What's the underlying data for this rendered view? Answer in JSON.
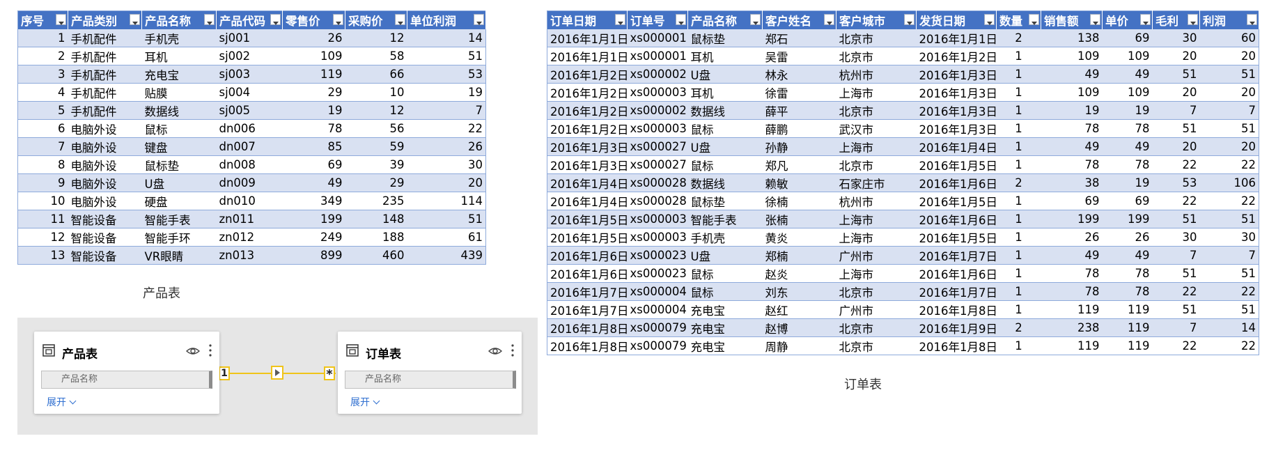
{
  "product_table": {
    "headers": [
      "序号",
      "产品类别",
      "产品名称",
      "产品代码",
      "零售价",
      "采购价",
      "单位利润"
    ],
    "rows": [
      [
        "1",
        "手机配件",
        "手机壳",
        "sj001",
        "26",
        "12",
        "14"
      ],
      [
        "2",
        "手机配件",
        "耳机",
        "sj002",
        "109",
        "58",
        "51"
      ],
      [
        "3",
        "手机配件",
        "充电宝",
        "sj003",
        "119",
        "66",
        "53"
      ],
      [
        "4",
        "手机配件",
        "贴膜",
        "sj004",
        "29",
        "10",
        "19"
      ],
      [
        "5",
        "手机配件",
        "数据线",
        "sj005",
        "19",
        "12",
        "7"
      ],
      [
        "6",
        "电脑外设",
        "鼠标",
        "dn006",
        "78",
        "56",
        "22"
      ],
      [
        "7",
        "电脑外设",
        "键盘",
        "dn007",
        "85",
        "59",
        "26"
      ],
      [
        "8",
        "电脑外设",
        "鼠标垫",
        "dn008",
        "69",
        "39",
        "30"
      ],
      [
        "9",
        "电脑外设",
        "U盘",
        "dn009",
        "49",
        "29",
        "20"
      ],
      [
        "10",
        "电脑外设",
        "硬盘",
        "dn010",
        "349",
        "235",
        "114"
      ],
      [
        "11",
        "智能设备",
        "智能手表",
        "zn011",
        "199",
        "148",
        "51"
      ],
      [
        "12",
        "智能设备",
        "智能手环",
        "zn012",
        "249",
        "188",
        "61"
      ],
      [
        "13",
        "智能设备",
        "VR眼睛",
        "zn013",
        "899",
        "460",
        "439"
      ]
    ],
    "caption": "产品表"
  },
  "order_table": {
    "headers": [
      "订单日期",
      "订单号",
      "产品名称",
      "客户姓名",
      "客户城市",
      "发货日期",
      "数量",
      "销售额",
      "单价",
      "毛利",
      "利润"
    ],
    "rows": [
      [
        "2016年1月1日",
        "xs000001",
        "鼠标垫",
        "郑石",
        "北京市",
        "2016年1月1日",
        "2",
        "138",
        "69",
        "30",
        "60"
      ],
      [
        "2016年1月1日",
        "xs000001",
        "耳机",
        "吴雷",
        "北京市",
        "2016年1月2日",
        "1",
        "109",
        "109",
        "20",
        "20"
      ],
      [
        "2016年1月2日",
        "xs000002",
        "U盘",
        "林永",
        "杭州市",
        "2016年1月3日",
        "1",
        "49",
        "49",
        "51",
        "51"
      ],
      [
        "2016年1月2日",
        "xs000003",
        "耳机",
        "徐雷",
        "上海市",
        "2016年1月3日",
        "1",
        "109",
        "109",
        "20",
        "20"
      ],
      [
        "2016年1月2日",
        "xs000002",
        "数据线",
        "薛平",
        "北京市",
        "2016年1月3日",
        "1",
        "19",
        "19",
        "7",
        "7"
      ],
      [
        "2016年1月2日",
        "xs000003",
        "鼠标",
        "薛鹏",
        "武汉市",
        "2016年1月3日",
        "1",
        "78",
        "78",
        "51",
        "51"
      ],
      [
        "2016年1月3日",
        "xs000027",
        "U盘",
        "孙静",
        "上海市",
        "2016年1月4日",
        "1",
        "49",
        "49",
        "20",
        "20"
      ],
      [
        "2016年1月3日",
        "xs000027",
        "鼠标",
        "郑凡",
        "北京市",
        "2016年1月5日",
        "1",
        "78",
        "78",
        "22",
        "22"
      ],
      [
        "2016年1月4日",
        "xs000028",
        "数据线",
        "赖敏",
        "石家庄市",
        "2016年1月6日",
        "2",
        "38",
        "19",
        "53",
        "106"
      ],
      [
        "2016年1月4日",
        "xs000028",
        "鼠标垫",
        "徐楠",
        "杭州市",
        "2016年1月5日",
        "1",
        "69",
        "69",
        "22",
        "22"
      ],
      [
        "2016年1月5日",
        "xs000003",
        "智能手表",
        "张楠",
        "上海市",
        "2016年1月6日",
        "1",
        "199",
        "199",
        "51",
        "51"
      ],
      [
        "2016年1月5日",
        "xs000003",
        "手机壳",
        "黄炎",
        "上海市",
        "2016年1月5日",
        "1",
        "26",
        "26",
        "30",
        "30"
      ],
      [
        "2016年1月6日",
        "xs000023",
        "U盘",
        "郑楠",
        "广州市",
        "2016年1月7日",
        "1",
        "49",
        "49",
        "7",
        "7"
      ],
      [
        "2016年1月6日",
        "xs000023",
        "鼠标",
        "赵炎",
        "上海市",
        "2016年1月6日",
        "1",
        "78",
        "78",
        "51",
        "51"
      ],
      [
        "2016年1月7日",
        "xs000004",
        "鼠标",
        "刘东",
        "北京市",
        "2016年1月7日",
        "1",
        "78",
        "78",
        "22",
        "22"
      ],
      [
        "2016年1月7日",
        "xs000004",
        "充电宝",
        "赵红",
        "广州市",
        "2016年1月8日",
        "1",
        "119",
        "119",
        "51",
        "51"
      ],
      [
        "2016年1月8日",
        "xs000079",
        "充电宝",
        "赵博",
        "北京市",
        "2016年1月9日",
        "2",
        "238",
        "119",
        "7",
        "14"
      ],
      [
        "2016年1月8日",
        "xs000079",
        "充电宝",
        "周静",
        "北京市",
        "2016年1月8日",
        "1",
        "119",
        "119",
        "22",
        "22"
      ]
    ],
    "caption": "订单表"
  },
  "model": {
    "left_card": {
      "title": "产品表",
      "field": "产品名称",
      "expand": "展开",
      "icon": "table-icon"
    },
    "right_card": {
      "title": "订单表",
      "field": "产品名称",
      "expand": "展开",
      "icon": "table-icon"
    },
    "relationship": {
      "one_side": "1",
      "many_side": "*"
    },
    "line_color": "#f0c419"
  },
  "colors": {
    "header": "#4472c4",
    "band": "#d9e1f2",
    "border": "#8eaadb"
  }
}
